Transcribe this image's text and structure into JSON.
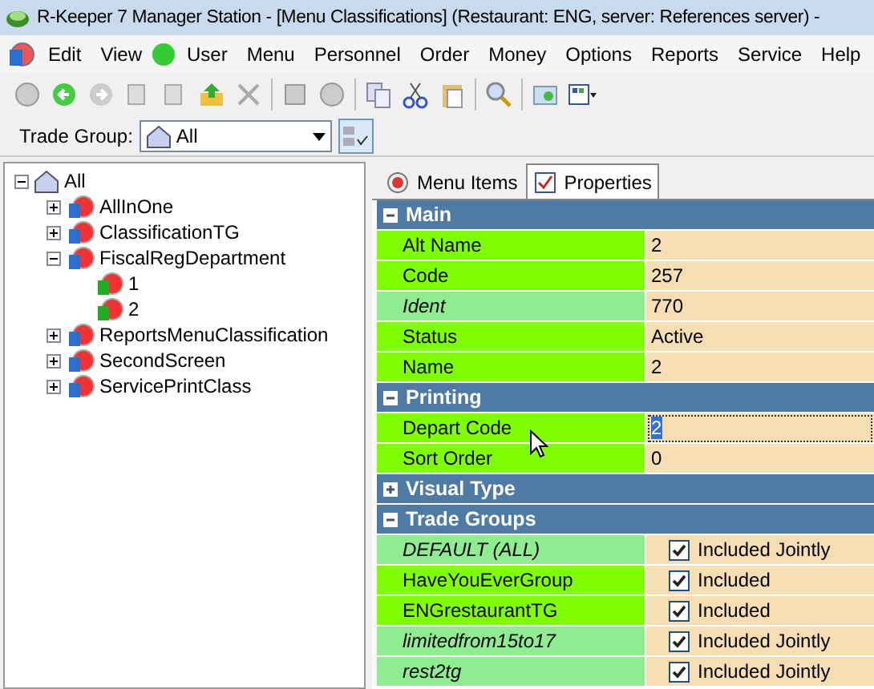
{
  "window": {
    "title": "R-Keeper 7 Manager Station - [Menu Classifications] (Restaurant: ENG, server: References server) -"
  },
  "menu": [
    "Edit",
    "View",
    "User",
    "Menu",
    "Personnel",
    "Order",
    "Money",
    "Options",
    "Reports",
    "Service",
    "Help"
  ],
  "trade_group": {
    "label": "Trade Group:",
    "value": "All"
  },
  "tree": {
    "label": "All",
    "expanded": true,
    "children": [
      {
        "label": "AllInOne",
        "expanded": false
      },
      {
        "label": "ClassificationTG",
        "expanded": false
      },
      {
        "label": "FiscalRegDepartment",
        "expanded": true,
        "children": [
          {
            "label": "1"
          },
          {
            "label": "2"
          }
        ]
      },
      {
        "label": "ReportsMenuClassification",
        "expanded": false
      },
      {
        "label": "SecondScreen",
        "expanded": false
      },
      {
        "label": "ServicePrintClass",
        "expanded": false
      }
    ]
  },
  "tabs": [
    {
      "label": "Menu Items",
      "selected": false
    },
    {
      "label": "Properties",
      "selected": true
    }
  ],
  "groups": [
    {
      "title": "Main",
      "expanded": true,
      "rows": [
        {
          "kind": "field",
          "name": "Alt Name",
          "value": "2",
          "inherited": false,
          "editing": false
        },
        {
          "kind": "field",
          "name": "Code",
          "value": "257",
          "inherited": false,
          "editing": false
        },
        {
          "kind": "field",
          "name": "Ident",
          "value": "770",
          "inherited": true,
          "editing": false
        },
        {
          "kind": "field",
          "name": "Status",
          "value": "Active",
          "inherited": false,
          "editing": false
        },
        {
          "kind": "field",
          "name": "Name",
          "value": "2",
          "inherited": false,
          "editing": false
        }
      ]
    },
    {
      "title": "Printing",
      "expanded": true,
      "rows": [
        {
          "kind": "field",
          "name": "Depart Code",
          "value": "2",
          "inherited": false,
          "editing": true
        },
        {
          "kind": "field",
          "name": "Sort Order",
          "value": "0",
          "inherited": false,
          "editing": false
        }
      ]
    },
    {
      "title": "Visual Type",
      "expanded": false
    },
    {
      "title": "Trade Groups",
      "expanded": true,
      "rows": [
        {
          "kind": "check",
          "name": "DEFAULT (ALL)",
          "value": "Included Jointly",
          "inherited": true,
          "checked": true
        },
        {
          "kind": "check",
          "name": "HaveYouEverGroup",
          "value": "Included",
          "inherited": false,
          "checked": true
        },
        {
          "kind": "check",
          "name": "ENGrestaurantTG",
          "value": "Included",
          "inherited": false,
          "checked": true
        },
        {
          "kind": "check",
          "name": "limitedfrom15to17",
          "value": "Included Jointly",
          "inherited": true,
          "checked": true
        },
        {
          "kind": "check",
          "name": "rest2tg",
          "value": "Included Jointly",
          "inherited": true,
          "checked": true
        }
      ]
    }
  ]
}
